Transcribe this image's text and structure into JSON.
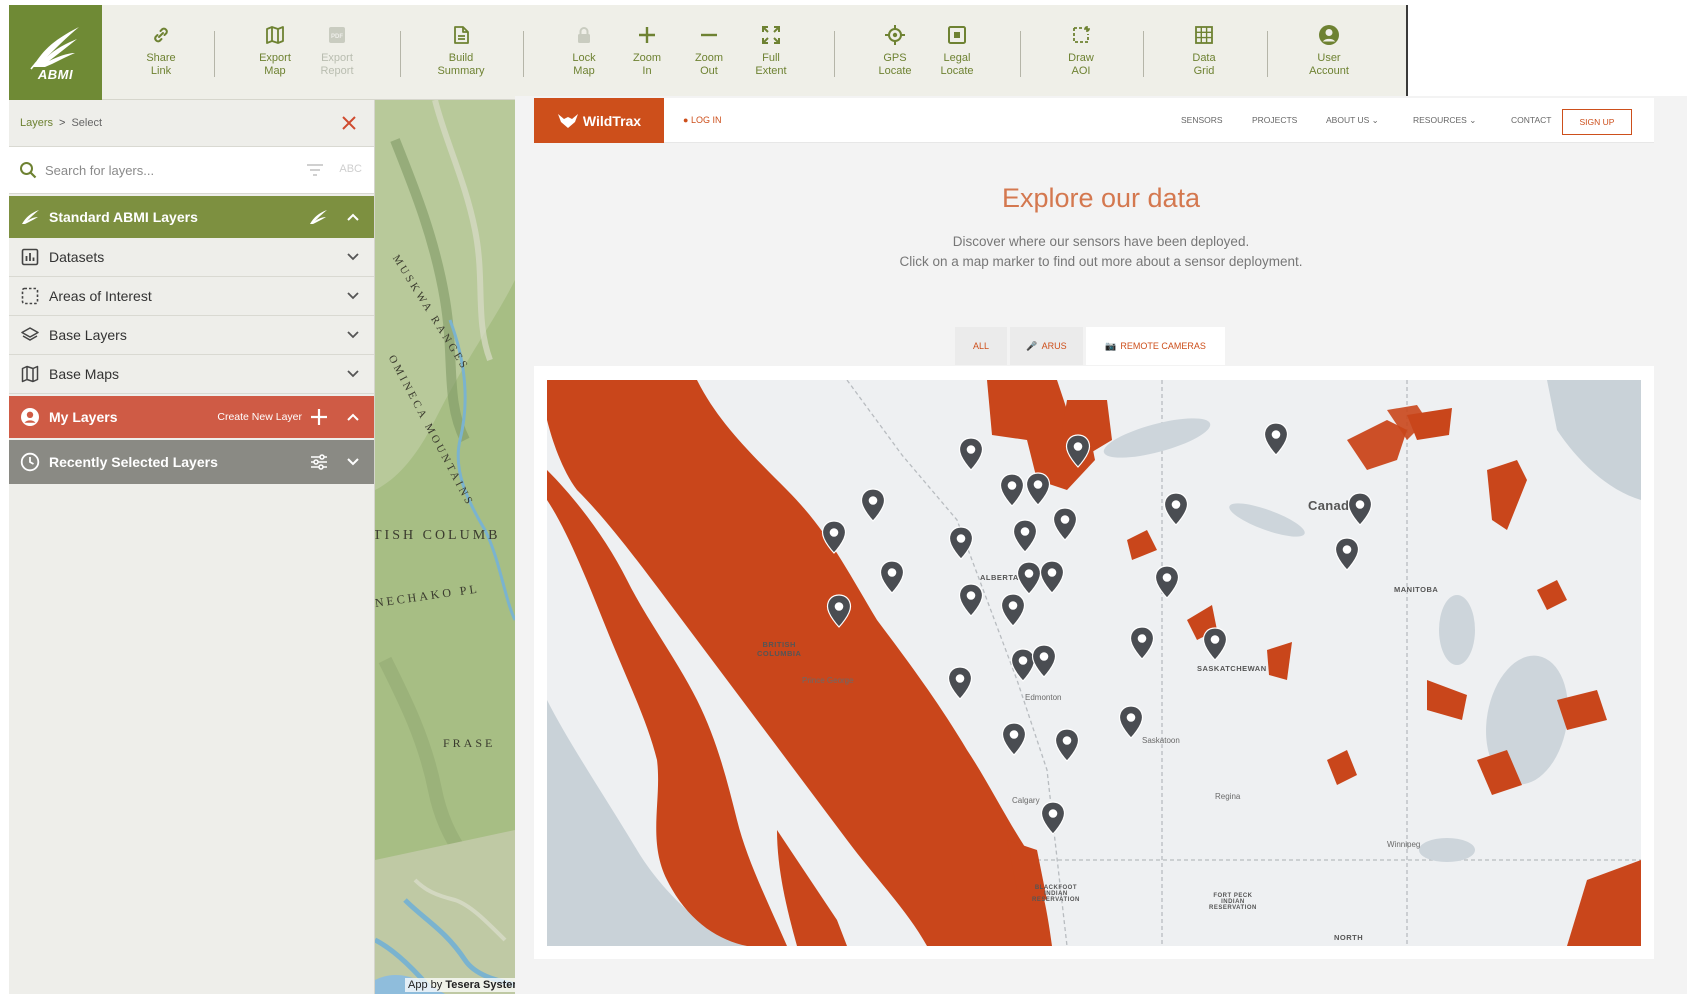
{
  "toolbar": {
    "logo_text": "ABMI",
    "tools": [
      {
        "id": "share-link",
        "icon": "link-icon",
        "label": "Share\nLink",
        "enabled": true
      },
      {
        "id": "export-map",
        "icon": "map-icon",
        "label": "Export\nMap",
        "enabled": true
      },
      {
        "id": "export-report",
        "icon": "pdf-icon",
        "label": "Export\nReport",
        "enabled": false
      },
      {
        "id": "build-summary",
        "icon": "document-icon",
        "label": "Build\nSummary",
        "enabled": true
      },
      {
        "id": "lock-map",
        "icon": "lock-icon",
        "label": "Lock\nMap",
        "enabled": true
      },
      {
        "id": "zoom-in",
        "icon": "plus-icon",
        "label": "Zoom\nIn",
        "enabled": true
      },
      {
        "id": "zoom-out",
        "icon": "minus-icon",
        "label": "Zoom\nOut",
        "enabled": true
      },
      {
        "id": "full-extent",
        "icon": "expand-icon",
        "label": "Full\nExtent",
        "enabled": true
      },
      {
        "id": "gps-locate",
        "icon": "crosshair-icon",
        "label": "GPS\nLocate",
        "enabled": true
      },
      {
        "id": "legal-locate",
        "icon": "square-target-icon",
        "label": "Legal\nLocate",
        "enabled": true
      },
      {
        "id": "draw-aoi",
        "icon": "draw-polygon-icon",
        "label": "Draw\nAOI",
        "enabled": true
      },
      {
        "id": "data-grid",
        "icon": "grid-icon",
        "label": "Data\nGrid",
        "enabled": true
      },
      {
        "id": "user-account",
        "icon": "user-circle-icon",
        "label": "User\nAccount",
        "enabled": true
      }
    ]
  },
  "panel": {
    "breadcrumb": {
      "root": "Layers",
      "separator": ">",
      "current": "Select"
    },
    "search": {
      "placeholder": "Search for layers...",
      "mode_label": "ABC"
    },
    "standard_group": {
      "label": "Standard ABMI Layers"
    },
    "rows": [
      {
        "id": "datasets",
        "icon": "bar-chart-icon",
        "label": "Datasets"
      },
      {
        "id": "areas-of-interest",
        "icon": "dashed-square-icon",
        "label": "Areas of Interest"
      },
      {
        "id": "base-layers",
        "icon": "layers-icon",
        "label": "Base Layers"
      },
      {
        "id": "base-maps",
        "icon": "map-icon",
        "label": "Base Maps"
      }
    ],
    "my_layers": {
      "label": "My Layers",
      "create_label": "Create New Layer"
    },
    "recent": {
      "label": "Recently Selected Layers"
    }
  },
  "map_strip": {
    "labels": [
      "TISH COLUMB",
      "NECHAKO PL",
      "FRASE",
      "MUSKWA RANGES",
      "OMINECA MOUNTAINS"
    ],
    "credit_prefix": "App by",
    "credit_name": "Tesera Systems"
  },
  "wildtrax": {
    "brand": "WildTrax",
    "login": "LOG IN",
    "nav": [
      "SENSORS",
      "PROJECTS",
      "ABOUT US",
      "RESOURCES",
      "CONTACT"
    ],
    "signup": "SIGN UP",
    "title": "Explore our data",
    "subtitle_1": "Discover where our sensors have been deployed.",
    "subtitle_2": "Click on a map marker to find out more about a sensor deployment.",
    "tabs": [
      {
        "label": "ALL",
        "active": false
      },
      {
        "label": "ARUS",
        "active": false
      },
      {
        "label": "REMOTE CAMERAS",
        "active": true
      }
    ],
    "map_labels": {
      "canada": "Canada",
      "alberta": "ALBERTA",
      "british_columbia": "BRITISH\nCOLUMBIA",
      "saskatchewan": "SASKATCHEWAN",
      "manitoba": "MANITOBA",
      "north": "NORTH",
      "edmonton": "Edmonton",
      "calgary": "Calgary",
      "winnipeg": "Winnipeg",
      "prince_george": "Prince George",
      "saskatoon": "Saskatoon",
      "regina": "Regina",
      "blackfoot": "BLACKFOOT\nINDIAN\nRESERVATION",
      "fort_peck": "FORT PECK\nINDIAN\nRESERVATION"
    },
    "colors": {
      "brand": "#cd4f1b",
      "marker": "#4a4d52",
      "forest": "#c9461b"
    }
  }
}
